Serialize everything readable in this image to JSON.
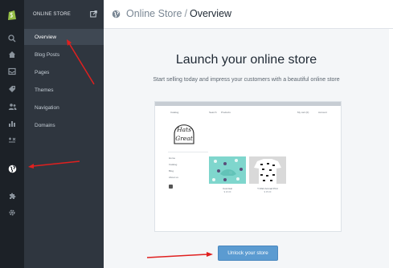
{
  "colors": {
    "rail_bg": "#1c2127",
    "subnav_bg": "#2f363f",
    "active_bg": "#3f4853",
    "brand_green": "#95bf47",
    "button_blue": "#5b9bd1",
    "annotation_red": "#e0201f"
  },
  "rail": {
    "icons": [
      "shopify-logo-icon",
      "search-icon",
      "home-icon",
      "orders-icon",
      "products-icon",
      "customers-icon",
      "reports-icon",
      "discounts-icon",
      "online-store-icon",
      "apps-icon",
      "settings-icon"
    ]
  },
  "subnav": {
    "title": "ONLINE STORE",
    "items": [
      {
        "label": "Overview"
      },
      {
        "label": "Blog Posts"
      },
      {
        "label": "Pages"
      },
      {
        "label": "Themes"
      },
      {
        "label": "Navigation"
      },
      {
        "label": "Domains"
      }
    ]
  },
  "header": {
    "breadcrumb_parent": "Online Store",
    "separator": "/",
    "breadcrumb_current": "Overview"
  },
  "main": {
    "title": "Launch your online store",
    "subtitle": "Start selling today and impress your customers with a beautiful online store",
    "unlock_button": "Unlock your store"
  },
  "preview": {
    "nav_left": "Catalog",
    "nav_center": [
      "Search",
      "Products"
    ],
    "nav_cart": "My cart (0)",
    "nav_account": "Account",
    "logo_text_1": "Hats",
    "logo_text_2": "Great",
    "sidebar_links": [
      "Home",
      "Catalog",
      "Blog",
      "About us"
    ],
    "products": [
      {
        "name": "Cool Hat",
        "price": "$ 20.00"
      },
      {
        "name": "T-Shirt Animal Print",
        "price": "$ 35.00"
      }
    ]
  }
}
